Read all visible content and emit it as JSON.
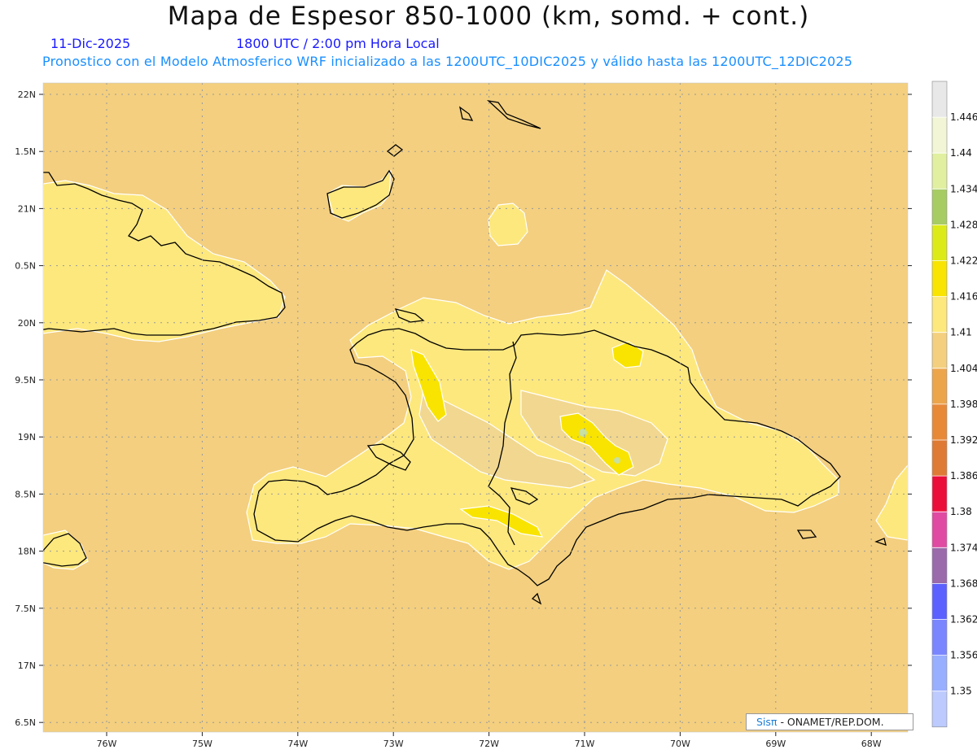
{
  "header": {
    "title": "Mapa de Espesor 850-1000 (km, somd. + cont.)",
    "date": "11-Dic-2025",
    "time": "1800 UTC / 2:00 pm Hora Local",
    "forecast": "Pronostico con el Modelo Atmosferico WRF inicializado a las 1200UTC_10DIC2025 y válido hasta las  1200UTC_12DIC2025"
  },
  "axes": {
    "lat_labels": [
      "22N",
      "1.5N",
      "21N",
      "0.5N",
      "20N",
      "9.5N",
      "19N",
      "8.5N",
      "18N",
      "7.5N",
      "17N",
      "6.5N"
    ],
    "lon_labels": [
      "76W",
      "75W",
      "74W",
      "73W",
      "72W",
      "71W",
      "70W",
      "69W",
      "68W"
    ],
    "lat_range": [
      16.5,
      22.0
    ],
    "lon_range": [
      -76.67,
      -67.33
    ]
  },
  "colorbar": {
    "labels": [
      "1.446",
      "1.44",
      "1.434",
      "1.428",
      "1.422",
      "1.416",
      "1.41",
      "1.404",
      "1.398",
      "1.392",
      "1.386",
      "1.38",
      "1.374",
      "1.368",
      "1.362",
      "1.356",
      "1.35"
    ],
    "colors": [
      "#e8e8e8",
      "#f2f6d6",
      "#e0f0a0",
      "#a8cc64",
      "#dcea18",
      "#f8e400",
      "#fde87e",
      "#f3cf7f",
      "#eda54c",
      "#e88938",
      "#df7a34",
      "#ec0e3a",
      "#e04aa2",
      "#9a6aaa",
      "#5c60fe",
      "#7a86ff",
      "#98aeff",
      "#bccafe"
    ]
  },
  "map": {
    "background_color": "#f3cf7f",
    "land_light_color": "#fde87e",
    "land_mid_color": "#f1d790",
    "max_color": "#f8e400"
  },
  "credit": {
    "brand": "Sisπ",
    "text": "- ONAMET/REP.DOM."
  }
}
